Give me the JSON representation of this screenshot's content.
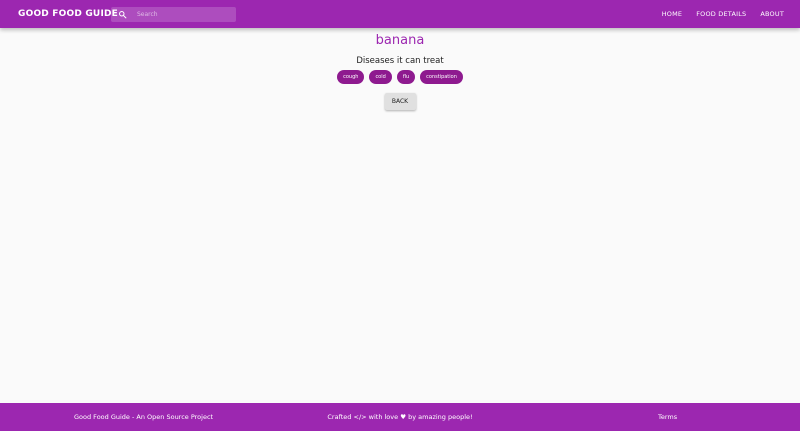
{
  "header": {
    "brand": "GOOD FOOD GUIDE",
    "search_placeholder": "Search",
    "nav": [
      "HOME",
      "FOOD DETAILS",
      "ABOUT"
    ]
  },
  "main": {
    "food_name": "banana",
    "section_title": "Diseases it can treat",
    "diseases": [
      "cough",
      "cold",
      "flu",
      "constipation"
    ],
    "back_label": "BACK"
  },
  "footer": {
    "left_text": "Good Food Guide - An Open Source Project",
    "middle_prefix": "Crafted </> with love ♥ by ",
    "middle_link": "amazing people!",
    "right_link": "Terms"
  },
  "colors": {
    "primary": "#9c27b0",
    "chip": "#8e1a8f",
    "background": "#fafafa",
    "button": "#e0e0e0"
  },
  "icons": {
    "search": "search-icon"
  }
}
